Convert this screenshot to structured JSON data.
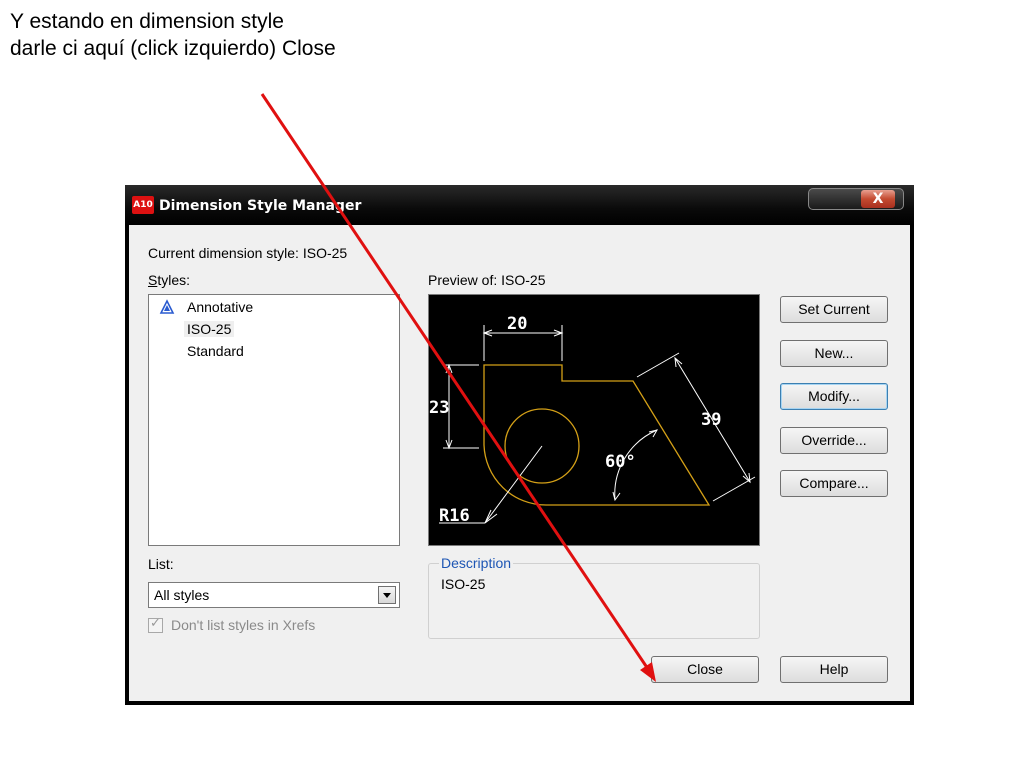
{
  "caption": {
    "line1": "Y estando en dimension style",
    "line2": "darle ci aquí (click izquierdo) Close"
  },
  "dialog": {
    "app_icon": "A10",
    "title": "Dimension Style Manager",
    "close_glyph": "X",
    "current_style_label": "Current dimension style: ISO-25",
    "styles_label": "Styles:",
    "styles": [
      {
        "label": "Annotative",
        "icon": "annotative-icon"
      },
      {
        "label": "ISO-25",
        "selected": true
      },
      {
        "label": "Standard"
      }
    ],
    "preview_label": "Preview of: ISO-25",
    "preview_dims": {
      "d1": "20",
      "d2": "23",
      "d3": "39",
      "d4": "60°",
      "d5": "R16"
    },
    "list_label": "List:",
    "list_value": "All styles",
    "dont_list_label": "Don't list styles in Xrefs",
    "description_title": "Description",
    "description_text": "ISO-25",
    "buttons": {
      "set_current": "Set Current",
      "new": "New...",
      "modify": "Modify...",
      "override": "Override...",
      "compare": "Compare...",
      "close": "Close",
      "help": "Help"
    }
  },
  "colors": {
    "annotation_arrow": "#e01010",
    "preview_geometry": "#d4a017",
    "preview_dims": "#ffffff",
    "description_title": "#1e56b4"
  }
}
